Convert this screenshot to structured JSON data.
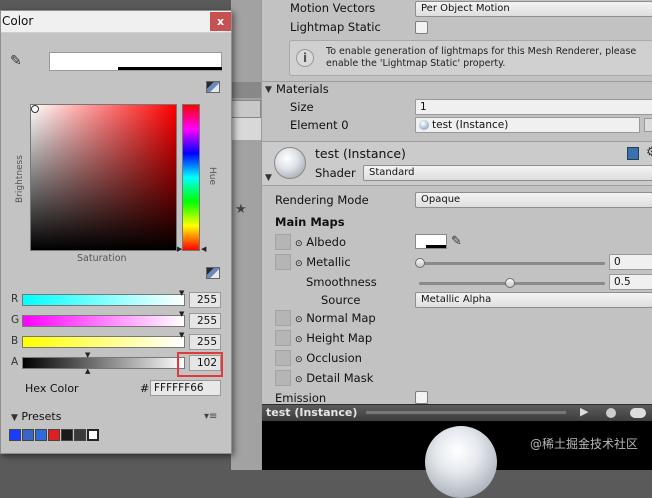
{
  "colors": {
    "inspector_bg": "#c2c2c2",
    "picker_bg": "#c3c3c3",
    "close_button": "#c75050",
    "highlight": "#e03a3a"
  },
  "inspector": {
    "motion_vectors": {
      "label": "Motion Vectors",
      "value": "Per Object Motion"
    },
    "lightmap_static": {
      "label": "Lightmap Static"
    },
    "help": "To enable generation of lightmaps for this Mesh Renderer, please enable the 'Lightmap Static' property.",
    "materials": {
      "header": "Materials",
      "size_label": "Size",
      "size_value": "1",
      "element_label": "Element 0",
      "element_value": "test (Instance)"
    },
    "material": {
      "name": "test (Instance)",
      "shader_label": "Shader",
      "shader_value": "Standard",
      "rendering_mode_label": "Rendering Mode",
      "rendering_mode_value": "Opaque",
      "main_maps": "Main Maps",
      "albedo": "Albedo",
      "metallic": "Metallic",
      "metallic_value": "0",
      "smoothness": "Smoothness",
      "smoothness_value": "0.5",
      "source": "Source",
      "source_value": "Metallic Alpha",
      "normal_map": "Normal Map",
      "height_map": "Height Map",
      "occlusion": "Occlusion",
      "detail_mask": "Detail Mask",
      "emission": "Emission"
    },
    "preview_title": "test (Instance)",
    "watermark": "@稀土掘金技术社区"
  },
  "color_window": {
    "title": "Color",
    "close": "x",
    "brightness_label": "Brightness",
    "saturation_label": "Saturation",
    "hue_label": "Hue",
    "channels": [
      {
        "label": "R",
        "value": "255"
      },
      {
        "label": "G",
        "value": "255"
      },
      {
        "label": "B",
        "value": "255"
      },
      {
        "label": "A",
        "value": "102"
      }
    ],
    "hex_label": "Hex Color",
    "hex_hash": "#",
    "hex_value": "FFFFFF66",
    "presets_label": "Presets",
    "preset_colors": [
      "#1a3cff",
      "#3a64c8",
      "#2d6bd8",
      "#e02020",
      "#1a1a1a",
      "#3a3a3a",
      "#ffffff"
    ]
  }
}
